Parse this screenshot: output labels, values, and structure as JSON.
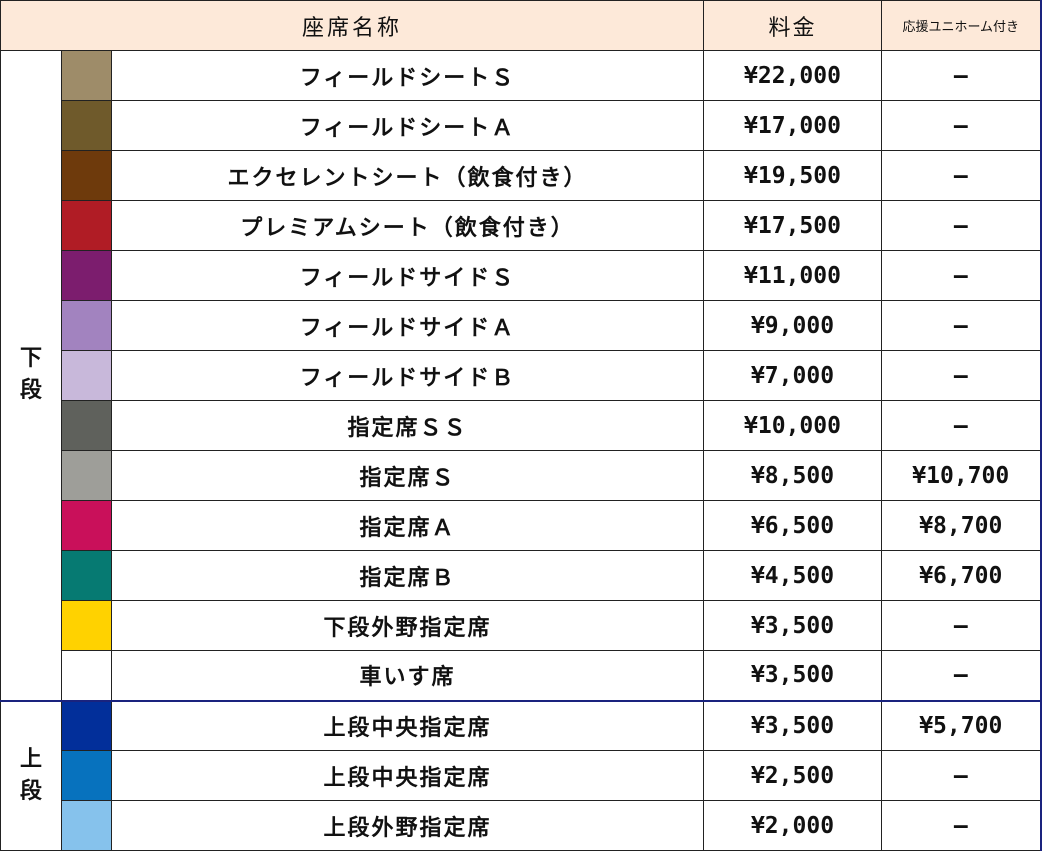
{
  "table": {
    "headers": {
      "name": "座席名称",
      "price": "料金",
      "uniform": "応援ユニホーム付き"
    },
    "sections": [
      {
        "label_chars": [
          "下",
          "段"
        ],
        "rows": [
          {
            "color": "#9e8c69",
            "name": "フィールドシートＳ",
            "price": "¥22,000",
            "uniform": "—"
          },
          {
            "color": "#6f5a2b",
            "name": "フィールドシートＡ",
            "price": "¥17,000",
            "uniform": "—"
          },
          {
            "color": "#6e3a0c",
            "name": "エクセレントシート（飲食付き）",
            "price": "¥19,500",
            "uniform": "—"
          },
          {
            "color": "#b01c25",
            "name": "プレミアムシート（飲食付き）",
            "price": "¥17,500",
            "uniform": "—"
          },
          {
            "color": "#7c1d6e",
            "name": "フィールドサイドＳ",
            "price": "¥11,000",
            "uniform": "—"
          },
          {
            "color": "#a283bf",
            "name": "フィールドサイドＡ",
            "price": "¥9,000",
            "uniform": "—"
          },
          {
            "color": "#c8b8da",
            "name": "フィールドサイドＢ",
            "price": "¥7,000",
            "uniform": "—"
          },
          {
            "color": "#5f615c",
            "name": "指定席ＳＳ",
            "price": "¥10,000",
            "uniform": "—"
          },
          {
            "color": "#9e9e99",
            "name": "指定席Ｓ",
            "price": "¥8,500",
            "uniform": "¥10,700"
          },
          {
            "color": "#c9105a",
            "name": "指定席Ａ",
            "price": "¥6,500",
            "uniform": "¥8,700"
          },
          {
            "color": "#067a72",
            "name": "指定席Ｂ",
            "price": "¥4,500",
            "uniform": "¥6,700"
          },
          {
            "color": "#ffd200",
            "name": "下段外野指定席",
            "price": "¥3,500",
            "uniform": "—"
          },
          {
            "color": "#ffffff",
            "name": "車いす席",
            "price": "¥3,500",
            "uniform": "—"
          }
        ]
      },
      {
        "label_chars": [
          "上",
          "段"
        ],
        "rows": [
          {
            "color": "#022f9a",
            "name": "上段中央指定席",
            "price": "¥3,500",
            "uniform": "¥5,700"
          },
          {
            "color": "#0772be",
            "name": "上段中央指定席",
            "price": "¥2,500",
            "uniform": "—"
          },
          {
            "color": "#86c2ec",
            "name": "上段外野指定席",
            "price": "¥2,000",
            "uniform": "—"
          }
        ]
      }
    ]
  }
}
